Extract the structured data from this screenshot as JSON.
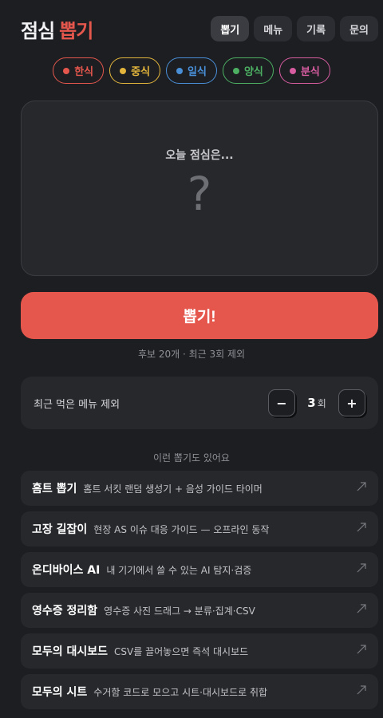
{
  "header": {
    "logo_part1": "점심",
    "logo_part2": "뽑기",
    "tabs": [
      {
        "label": "뽑기",
        "active": true
      },
      {
        "label": "메뉴",
        "active": false
      },
      {
        "label": "기록",
        "active": false
      },
      {
        "label": "문의",
        "active": false
      }
    ]
  },
  "categories": [
    {
      "label": "한식",
      "color": "#e5574d"
    },
    {
      "label": "중식",
      "color": "#e3b53c"
    },
    {
      "label": "일식",
      "color": "#4a90d9"
    },
    {
      "label": "양식",
      "color": "#4caf62"
    },
    {
      "label": "분식",
      "color": "#d75ca0"
    }
  ],
  "result": {
    "label": "오늘 점심은...",
    "value": "?"
  },
  "draw": {
    "button_label": "뽑기!",
    "info": "후보 20개 · 최근 3회 제외"
  },
  "exclude": {
    "label": "최근 먹은 메뉴 제외",
    "minus": "−",
    "value": "3",
    "unit": "회",
    "plus": "+"
  },
  "related": {
    "title": "이런 뽑기도 있어요",
    "items": [
      {
        "name": "홈트 뽑기",
        "desc": "홈트 서킷 랜덤 생성기 + 음성 가이드 타이머"
      },
      {
        "name": "고장 길잡이",
        "desc": "현장 AS 이슈 대응 가이드 — 오프라인 동작"
      },
      {
        "name": "온디바이스 AI",
        "desc": "내 기기에서 쓸 수 있는 AI 탐지·검증"
      },
      {
        "name": "영수증 정리함",
        "desc": "영수증 사진 드래그 → 분류·집계·CSV"
      },
      {
        "name": "모두의 대시보드",
        "desc": "CSV를 끌어놓으면 즉석 대시보드"
      },
      {
        "name": "모두의 시트",
        "desc": "수거함 코드로 모으고 시트·대시보드로 취합"
      }
    ]
  },
  "colors": {
    "accent": "#e5574d",
    "background": "#1c1e22",
    "card": "#26282c"
  }
}
